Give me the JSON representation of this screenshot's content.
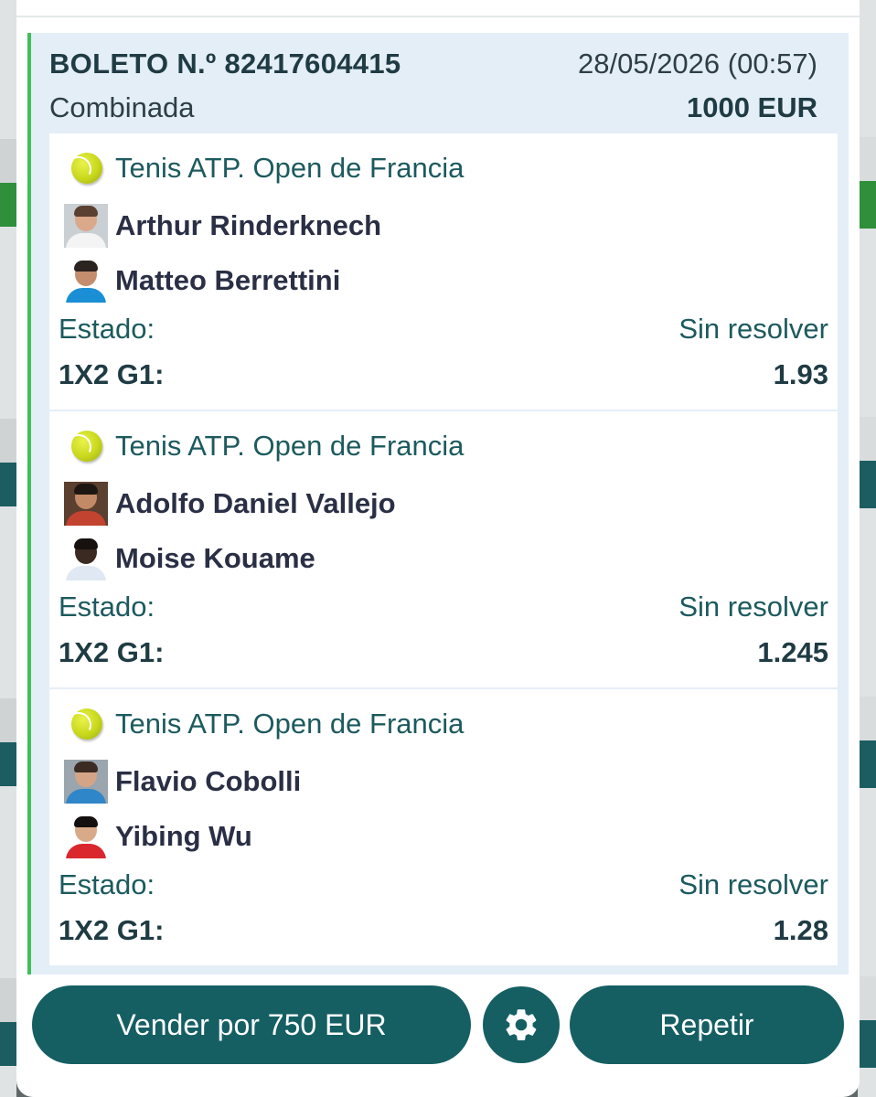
{
  "ticket": {
    "number_label": "BOLETO N.º 82417604415",
    "datetime": "28/05/2026 (00:57)",
    "type": "Combinada",
    "amount": "1000 EUR",
    "accent_color": "#3fbf5a"
  },
  "selections": [
    {
      "league": "Tenis ATP. Open de Francia",
      "league_icon": "tennis-ball-icon",
      "player1": "Arthur Rinderknech",
      "player2": "Matteo Berrettini",
      "status_label": "Estado:",
      "status_value": "Sin resolver",
      "market_label": "1X2 G1:",
      "odds": "1.93"
    },
    {
      "league": "Tenis ATP. Open de Francia",
      "league_icon": "tennis-ball-icon",
      "player1": "Adolfo Daniel Vallejo",
      "player2": "Moise Kouame",
      "status_label": "Estado:",
      "status_value": "Sin resolver",
      "market_label": "1X2 G1:",
      "odds": "1.245"
    },
    {
      "league": "Tenis ATP. Open de Francia",
      "league_icon": "tennis-ball-icon",
      "player1": "Flavio Cobolli",
      "player2": "Yibing Wu",
      "status_label": "Estado:",
      "status_value": "Sin resolver",
      "market_label": "1X2 G1:",
      "odds": "1.28"
    }
  ],
  "actions": {
    "sell_label": "Vender por 750 EUR",
    "settings_icon": "gear-icon",
    "repeat_label": "Repetir",
    "button_color": "#155f63"
  }
}
